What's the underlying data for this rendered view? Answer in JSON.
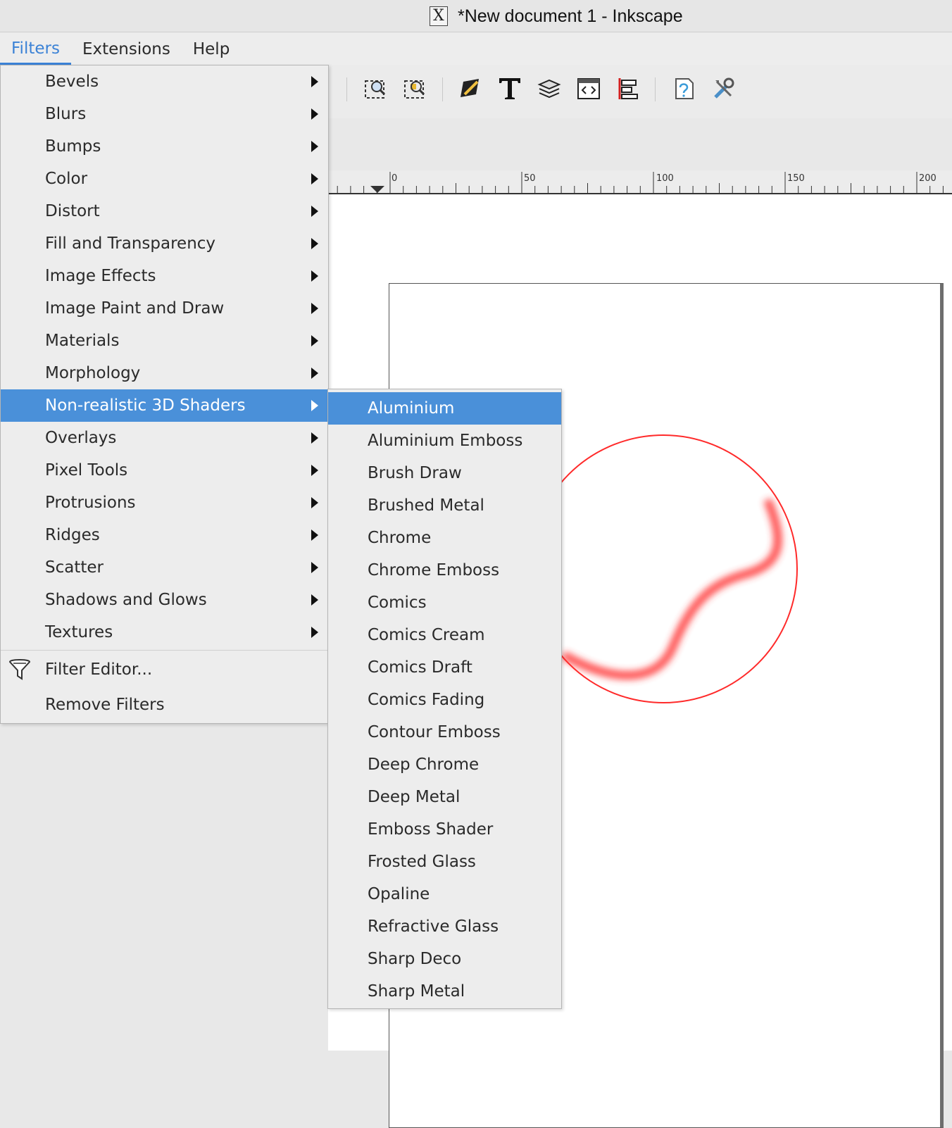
{
  "window": {
    "title": "*New document 1 - Inkscape",
    "app_icon_glyph": "X"
  },
  "menubar": {
    "items": [
      {
        "label": "Filters",
        "active": true
      },
      {
        "label": "Extensions",
        "active": false
      },
      {
        "label": "Help",
        "active": false
      }
    ]
  },
  "filters_menu": {
    "categories": [
      "Bevels",
      "Blurs",
      "Bumps",
      "Color",
      "Distort",
      "Fill and Transparency",
      "Image Effects",
      "Image Paint and Draw",
      "Materials",
      "Morphology",
      "Non-realistic 3D Shaders",
      "Overlays",
      "Pixel Tools",
      "Protrusions",
      "Ridges",
      "Scatter",
      "Shadows and Glows",
      "Textures"
    ],
    "highlighted": "Non-realistic 3D Shaders",
    "filter_editor_label": "Filter Editor...",
    "filter_editor_icon": "funnel-icon",
    "remove_filters_label": "Remove Filters"
  },
  "submenu": {
    "parent": "Non-realistic 3D Shaders",
    "items": [
      "Aluminium",
      "Aluminium Emboss",
      "Brush Draw",
      "Brushed Metal",
      "Chrome",
      "Chrome Emboss",
      "Comics",
      "Comics Cream",
      "Comics Draft",
      "Comics Fading",
      "Contour Emboss",
      "Deep Chrome",
      "Deep Metal",
      "Emboss Shader",
      "Frosted Glass",
      "Opaline",
      "Refractive Glass",
      "Sharp Deco",
      "Sharp Metal"
    ],
    "highlighted": "Aluminium"
  },
  "toolbar": {
    "icons": [
      "zoom-selection-icon",
      "zoom-drawing-icon",
      "fill-stroke-icon",
      "text-tool-icon",
      "layers-icon",
      "xml-editor-icon",
      "align-distribute-icon",
      "document-properties-icon",
      "preferences-icon"
    ]
  },
  "ruler": {
    "labels": [
      "0",
      "50",
      "100",
      "150",
      "200"
    ]
  },
  "colors": {
    "highlight": "#4a90d9",
    "menu_active_text": "#3b82d6",
    "shape_stroke": "#ff2020"
  }
}
